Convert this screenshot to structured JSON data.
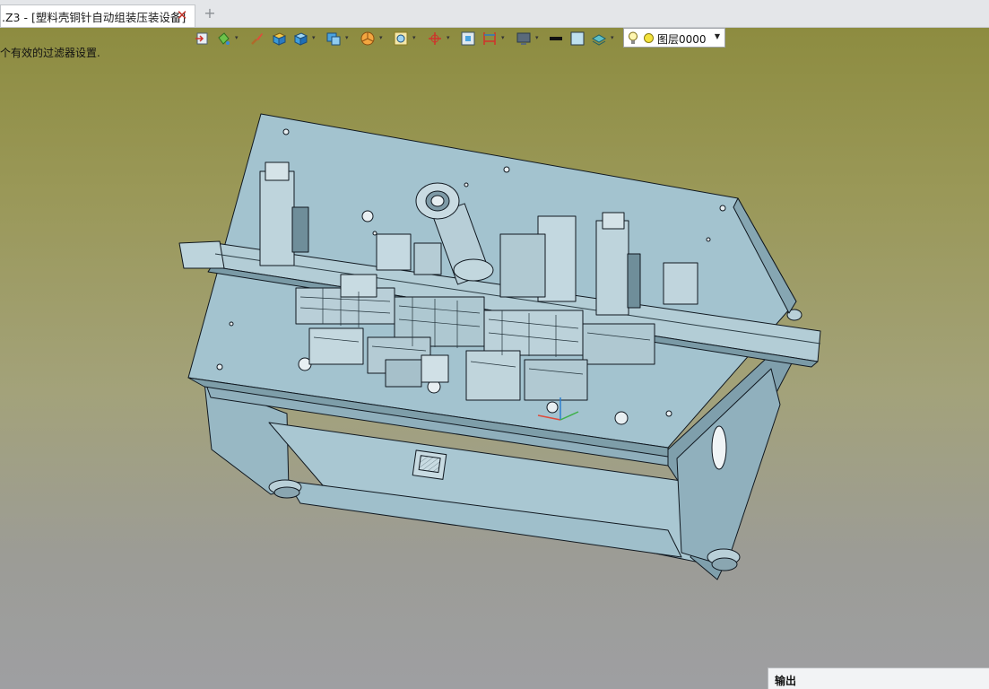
{
  "tab": {
    "title": ".Z3 - [塑料壳铜针自动组装压装设备]",
    "close_glyph": "✕",
    "add_glyph": "+"
  },
  "viewport": {
    "filter_message": "个有效的过滤器设置.",
    "background_top": "#8d8c40",
    "background_bottom": "#9e9fa2"
  },
  "toolbar": {
    "buttons": [
      {
        "icon": "import-icon"
      },
      {
        "icon": "paint-bucket-icon",
        "has_dropdown": true
      },
      {
        "icon": "brush-icon"
      },
      {
        "icon": "solid-shade-icon"
      },
      {
        "icon": "cube-icon",
        "has_dropdown": true
      },
      {
        "icon": "view-cube-icon",
        "has_dropdown": true
      },
      {
        "icon": "section-pie-icon",
        "has_dropdown": true
      },
      {
        "icon": "zoom-fit-icon",
        "has_dropdown": true
      },
      {
        "icon": "origin-axis-icon",
        "has_dropdown": true
      },
      {
        "icon": "frame-select-icon"
      },
      {
        "icon": "dimension-icon",
        "has_dropdown": true
      },
      {
        "icon": "display-monitor-icon",
        "has_dropdown": true
      },
      {
        "icon": "line-weight-icon"
      },
      {
        "icon": "color-swatch-icon"
      },
      {
        "icon": "layers-icon",
        "has_dropdown": true
      }
    ],
    "layer": {
      "label": "图层0000",
      "color": "#f3e23c"
    }
  },
  "output_panel": {
    "title": "输出"
  },
  "model_color": "#a3c3cf"
}
